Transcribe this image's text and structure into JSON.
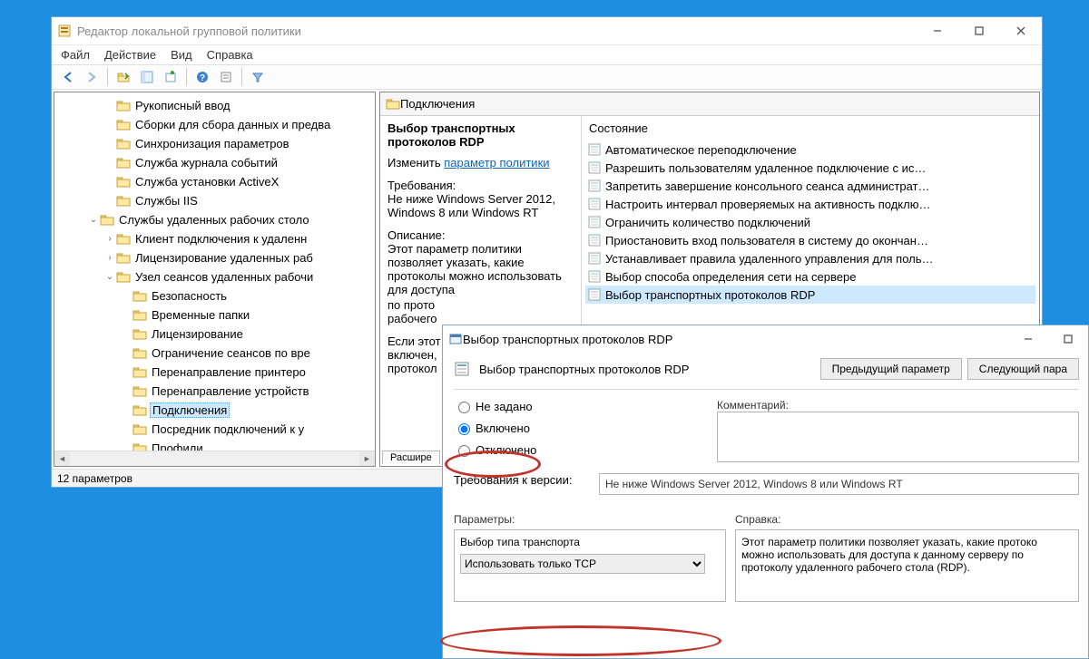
{
  "main": {
    "title": "Редактор локальной групповой политики",
    "menu": {
      "file": "Файл",
      "action": "Действие",
      "view": "Вид",
      "help": "Справка"
    },
    "status": "12 параметров",
    "right": {
      "header": "Подключения",
      "policy_title": "Выбор транспортных протоколов RDP",
      "edit_label": "Изменить",
      "edit_link": "параметр политики",
      "req_label": "Требования:",
      "req_text": "Не ниже Windows Server 2012, Windows 8 или Windows RT",
      "desc_label": "Описание:",
      "desc_text": "Этот параметр политики позволяет указать, какие протоколы можно использовать для доступа",
      "desc_tail1": "по прото",
      "desc_tail2": "рабочего",
      "desc_tail3": "Если этот",
      "desc_tail4": "включен,",
      "desc_tail5": "протокол",
      "tabs": {
        "extended": "Расшире"
      },
      "state_header": "Состояние",
      "items": [
        "Автоматическое переподключение",
        "Разрешить пользователям удаленное подключение с ис…",
        "Запретить завершение консольного сеанса администрат…",
        "Настроить интервал проверяемых на активность подклю…",
        "Ограничить количество подключений",
        "Приостановить вход пользователя в систему до окончан…",
        "Устанавливает правила удаленного управления для поль…",
        "Выбор способа определения сети на сервере",
        "Выбор транспортных протоколов RDP"
      ]
    },
    "tree": [
      {
        "indent": 3,
        "exp": "",
        "label": "Рукописный ввод"
      },
      {
        "indent": 3,
        "exp": "",
        "label": "Сборки для сбора данных и предва"
      },
      {
        "indent": 3,
        "exp": "",
        "label": "Синхронизация параметров"
      },
      {
        "indent": 3,
        "exp": "",
        "label": "Служба журнала событий"
      },
      {
        "indent": 3,
        "exp": "",
        "label": "Служба установки ActiveX"
      },
      {
        "indent": 3,
        "exp": "",
        "label": "Службы IIS"
      },
      {
        "indent": 2,
        "exp": "v",
        "label": "Службы удаленных рабочих столо"
      },
      {
        "indent": 3,
        "exp": ">",
        "label": "Клиент подключения к удаленн"
      },
      {
        "indent": 3,
        "exp": ">",
        "label": "Лицензирование удаленных раб"
      },
      {
        "indent": 3,
        "exp": "v",
        "label": "Узел сеансов удаленных рабочи"
      },
      {
        "indent": 4,
        "exp": "",
        "label": "Безопасность"
      },
      {
        "indent": 4,
        "exp": "",
        "label": "Временные папки"
      },
      {
        "indent": 4,
        "exp": "",
        "label": "Лицензирование"
      },
      {
        "indent": 4,
        "exp": "",
        "label": "Ограничение сеансов по вре"
      },
      {
        "indent": 4,
        "exp": "",
        "label": "Перенаправление принтеро"
      },
      {
        "indent": 4,
        "exp": "",
        "label": "Перенаправление устройств"
      },
      {
        "indent": 4,
        "exp": "",
        "label": "Подключения",
        "sel": true
      },
      {
        "indent": 4,
        "exp": "",
        "label": "Посредник подключений к у"
      },
      {
        "indent": 4,
        "exp": "",
        "label": "Профили"
      }
    ]
  },
  "dlg": {
    "title": "Выбор транспортных протоколов RDP",
    "heading": "Выбор транспортных протоколов RDP",
    "prev": "Предыдущий параметр",
    "next": "Следующий пара",
    "radio": {
      "not_set": "Не задано",
      "enabled": "Включено",
      "disabled": "Отключено"
    },
    "comment_label": "Комментарий:",
    "req_label": "Требования к версии:",
    "req_text": "Не ниже Windows Server 2012, Windows 8 или Windows RT",
    "params_label": "Параметры:",
    "help_label": "Справка:",
    "help_text": "Этот параметр политики позволяет указать, какие протоко можно использовать для доступа к данному серверу по протоколу удаленного рабочего стола (RDP).",
    "transport_label": "Выбор типа транспорта",
    "transport_value": "Использовать только TCP"
  }
}
